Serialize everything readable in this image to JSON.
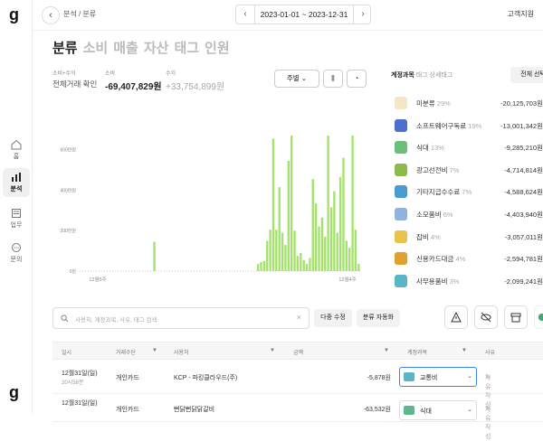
{
  "logo": "g",
  "nav": [
    {
      "label": "홈"
    },
    {
      "label": "분석"
    },
    {
      "label": "업무"
    },
    {
      "label": "문의"
    }
  ],
  "topbar": {
    "breadcrumb": "분석  /  분류",
    "date_range": "2023-01-01 ~ 2023-12-31",
    "support": "고객지원"
  },
  "tabs": [
    "분류",
    "소비",
    "매출",
    "자산",
    "태그",
    "인원"
  ],
  "stats": {
    "all_label": "소비+수익",
    "all_value": "전체거래 확인",
    "spend_label": "소비",
    "spend_value": "-69,407,829원",
    "income_label": "수익",
    "income_value": "+33,754,899원"
  },
  "controls": {
    "period": "주별"
  },
  "chart_data": {
    "type": "bar",
    "ylim": [
      0,
      6500000
    ],
    "yticks": [
      "0원",
      "200만원",
      "400만원",
      "600만원"
    ],
    "xlabels": [
      "12월5주",
      "12월4주"
    ],
    "color": "#a3e36b",
    "values": [
      0,
      0,
      0,
      0,
      0,
      0,
      0,
      0,
      0,
      0,
      0,
      0,
      0,
      0,
      0,
      0,
      0,
      0,
      0,
      0,
      0,
      0,
      0,
      0,
      1450000,
      0,
      0,
      0,
      0,
      0,
      0,
      0,
      0,
      0,
      0,
      0,
      0,
      0,
      0,
      0,
      0,
      0,
      0,
      0,
      0,
      0,
      0,
      0,
      0,
      0,
      0,
      0,
      0,
      0,
      0,
      0,
      0,
      0,
      350000,
      450000,
      500000,
      1500000,
      2050000,
      6550000,
      2050000,
      4150000,
      1900000,
      1300000,
      5450000,
      7300000,
      2000000,
      750000,
      900000,
      550000,
      350000,
      650000,
      4550000,
      3350000,
      2200000,
      2650000,
      1700000,
      6700000,
      3150000,
      3950000,
      1900000,
      4650000,
      5600000,
      1500000,
      1150000,
      8050000,
      2050000,
      350000
    ]
  },
  "right_panel": {
    "tab_active": "계정과목",
    "tab_others": "태그  상세태그",
    "select_all": "전체 선택",
    "items": [
      {
        "name": "미분류",
        "pct": "29%",
        "amount": "-20,125,703원",
        "color": "#f5e6c8"
      },
      {
        "name": "소프트웨어구독료",
        "pct": "19%",
        "amount": "-13,001,342원",
        "color": "#4a6fd1"
      },
      {
        "name": "식대",
        "pct": "13%",
        "amount": "-9,285,210원",
        "color": "#6bbf7a"
      },
      {
        "name": "광고선전비",
        "pct": "7%",
        "amount": "-4,714,814원",
        "color": "#8fb94a"
      },
      {
        "name": "기타지급수수료",
        "pct": "7%",
        "amount": "-4,588,624원",
        "color": "#4a9bd1"
      },
      {
        "name": "소모품비",
        "pct": "6%",
        "amount": "-4,403,940원",
        "color": "#8fb3e0"
      },
      {
        "name": "잡비",
        "pct": "4%",
        "amount": "-3,057,011원",
        "color": "#e8c24a"
      },
      {
        "name": "신용카드대금",
        "pct": "4%",
        "amount": "-2,594,781원",
        "color": "#e0a030"
      },
      {
        "name": "사무용품비",
        "pct": "3%",
        "amount": "-2,099,241원",
        "color": "#5ab5c8"
      }
    ]
  },
  "toolbar": {
    "search_placeholder": "사용처, 계정과목, 사유, 태그 검색",
    "multi_edit": "다중 수정",
    "auto_classify": "분류 자동화"
  },
  "table": {
    "headers": [
      "일시",
      "거래수단",
      "사용처",
      "금액",
      "계정과목",
      "사유"
    ],
    "rows": [
      {
        "date": "12월31일(일)",
        "time": "20시58분",
        "method": "개인카드",
        "merchant": "KCP - 파킹클라우드(주)",
        "amount": "-5,878원",
        "category": "교통비",
        "reason": "사유 작성"
      },
      {
        "date": "12월31일(일)",
        "time": "",
        "method": "개인카드",
        "merchant": "뻔닭뻔닭닭갈비",
        "amount": "-63,532원",
        "category": "식대",
        "reason": "사유 작성"
      }
    ]
  }
}
